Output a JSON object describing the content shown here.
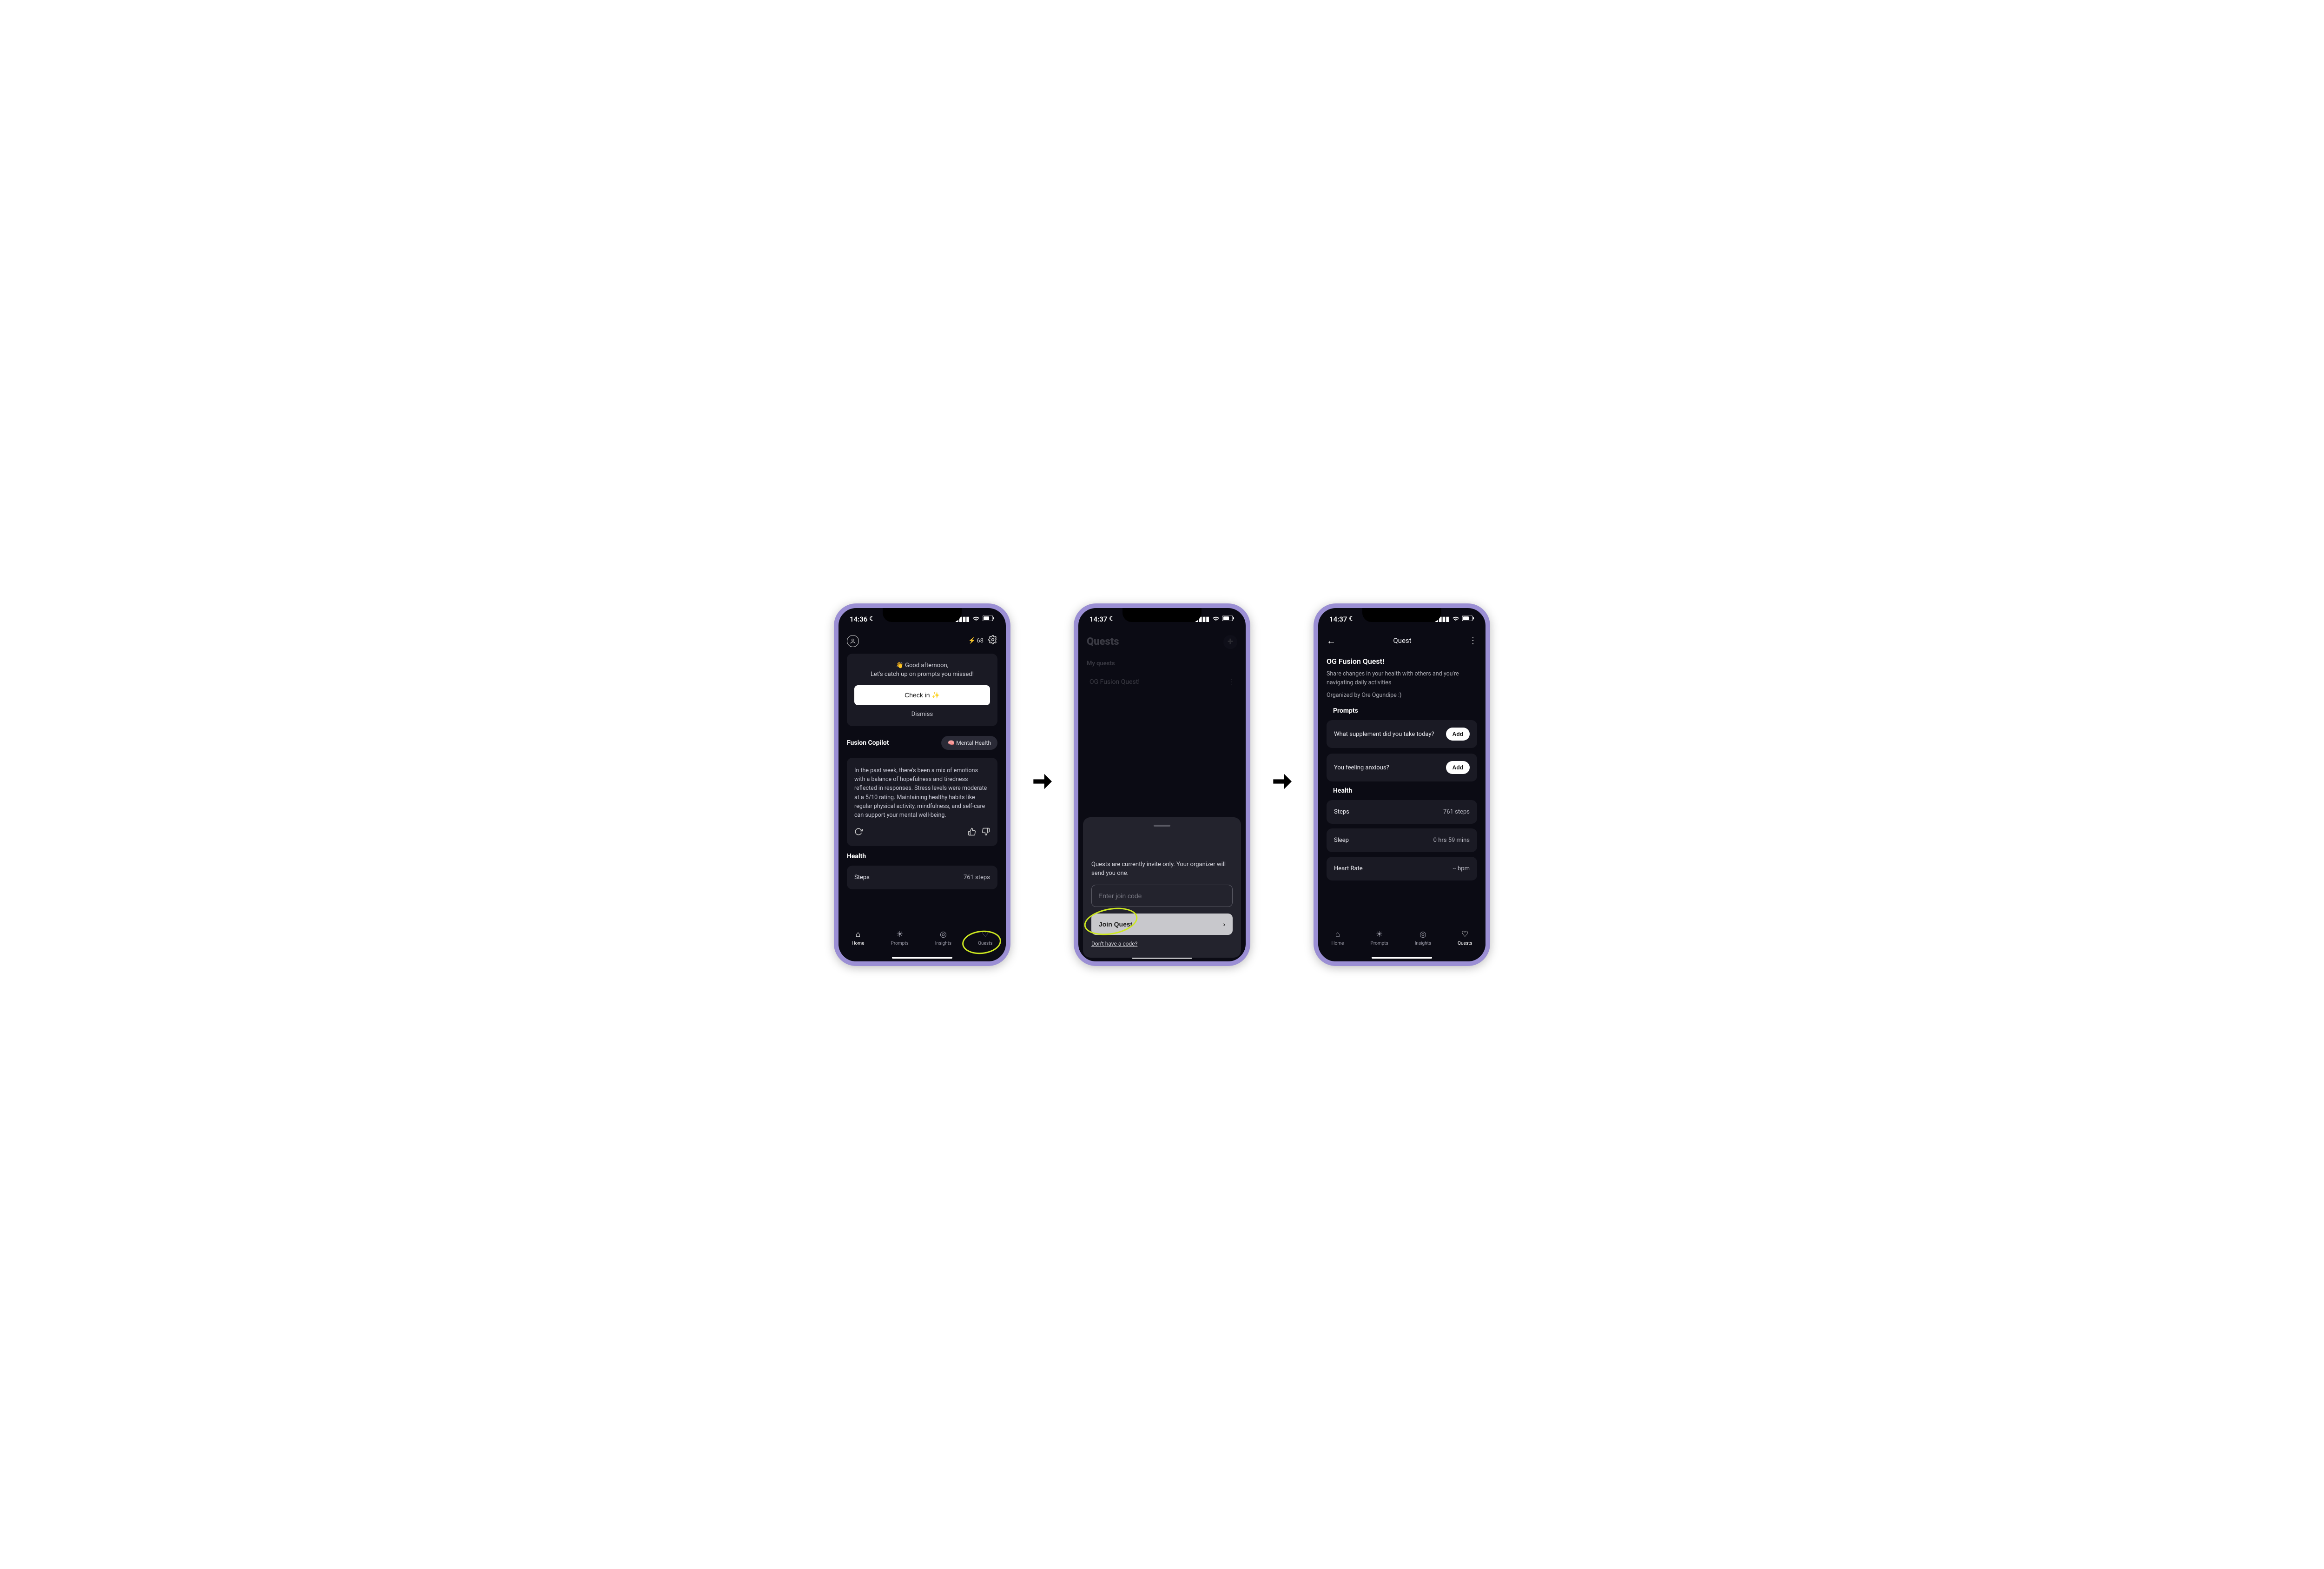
{
  "status": {
    "time1": "14:36",
    "time2": "14:37",
    "time3": "14:37"
  },
  "screen1": {
    "bolt_count": "68",
    "greeting": "👋 Good afternoon,",
    "greeting_sub": "Let's catch up on prompts you missed!",
    "checkin_label": "Check in ✨",
    "dismiss_label": "Dismiss",
    "copilot_title": "Fusion Copilot",
    "pill_label": "🧠 Mental Health",
    "copilot_message": "In the past week, there's been a mix of emotions with a balance of hopefulness and tiredness reflected in responses. Stress levels were moderate at a 5/10 rating. Maintaining healthy habits like regular physical activity, mindfulness, and self-care can support your mental well-being.",
    "health_title": "Health",
    "steps_label": "Steps",
    "steps_value": "761 steps"
  },
  "tabs": {
    "home": "Home",
    "prompts": "Prompts",
    "insights": "Insights",
    "quests": "Quests"
  },
  "screen2": {
    "header": "Quests",
    "my_quests": "My quests",
    "item1": "OG Fusion Quest!",
    "sheet_msg": "Quests are currently invite only. Your organizer will send you one.",
    "input_placeholder": "Enter join code",
    "join_label": "Join Quest",
    "no_code": "Don't have a code?"
  },
  "screen3": {
    "titlebar": "Quest",
    "quest_title": "OG Fusion Quest!",
    "quest_desc": "Share changes in your health with others and you're navigating daily activities",
    "organized": "Organized by Ore Ogundipe :)",
    "prompts_title": "Prompts",
    "prompt1": "What supplement did you take today?",
    "prompt2": "You feeling anxious?",
    "add_label": "Add",
    "health_title": "Health",
    "steps_label": "Steps",
    "steps_value": "761 steps",
    "sleep_label": "Sleep",
    "sleep_value": "0 hrs 59 mins",
    "hr_label": "Heart Rate",
    "hr_value": "-- bpm"
  }
}
